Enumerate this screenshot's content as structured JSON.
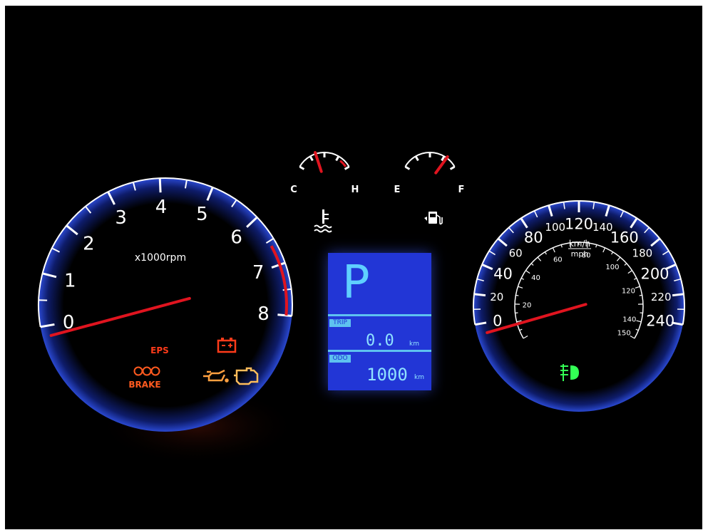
{
  "tachometer": {
    "scale_labels": [
      "0",
      "1",
      "2",
      "3",
      "4",
      "5",
      "6",
      "7",
      "8"
    ],
    "unit_label": "x1000rpm",
    "reading_rpm_x1000": 0
  },
  "temperature_gauge": {
    "low_label": "C",
    "high_label": "H",
    "level": 0.35
  },
  "fuel_gauge": {
    "empty_label": "E",
    "full_label": "F",
    "level": 0.8
  },
  "speedometer": {
    "kmh_labels": [
      "0",
      "20",
      "40",
      "60",
      "80",
      "100",
      "120",
      "140",
      "160",
      "180",
      "200",
      "220",
      "240"
    ],
    "mph_labels": [
      "20",
      "40",
      "60",
      "80",
      "100",
      "120",
      "140",
      "150"
    ],
    "unit_label_top": "km/h",
    "unit_label_bottom": "mph",
    "reading_kmh": 0
  },
  "warning_lights": {
    "eps_label": "EPS",
    "brake_label": "BRAKE"
  },
  "display": {
    "gear": "P",
    "trip_tag": "TRIP",
    "trip_value": "0.0",
    "trip_unit": "km",
    "odo_tag": "ODO",
    "odo_value": "1000",
    "odo_unit": "km"
  },
  "colors": {
    "dial_blue": "#1d35a8",
    "needle_red": "#e0141f",
    "warning_red": "#ff3b1a",
    "warning_amber": "#ffb347",
    "lcd_blue": "#2236d6",
    "fog_green": "#33ff55"
  }
}
